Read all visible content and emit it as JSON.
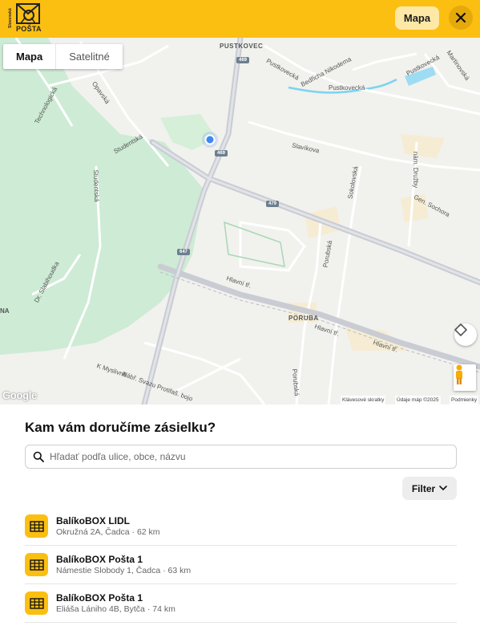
{
  "header": {
    "logo_side_text": "Slovenská",
    "logo_text": "POŠTA",
    "map_button": "Mapa",
    "close_icon": "close-icon"
  },
  "map": {
    "tabs": [
      {
        "label": "Mapa",
        "active": true
      },
      {
        "label": "Satelitné",
        "active": false
      }
    ],
    "labels": {
      "pustkovec": "PUSTKOVEC",
      "bedricha": "Bedřicha Nikodema",
      "pustkovecka1": "Pustkovecká",
      "pustkovecka2": "Pustkovecká",
      "pustkovecka3": "Pustkovecká",
      "martinovska": "Martinovská",
      "technologicka": "Technologická",
      "opavska": "Opavská",
      "studentska": "Studentská",
      "studentska2": "Studentská",
      "slavikova": "Slavíkova",
      "sokolovska": "Sokolovská",
      "druzby": "nám. Družby",
      "sochora": "Gen. Sochora",
      "porubska": "Porubská",
      "porubska2": "Porubská",
      "hlavni1": "Hlavní tř.",
      "hlavni2": "Hlavní tř.",
      "hlavni3": "Hlavní tř.",
      "poruba": "PORUBA",
      "slabihoudka": "Dr. Slabihoudka",
      "myslivne": "K Myslivně",
      "protifas": "Nábř. Svazu Protifaš. bojo",
      "na": "NA"
    },
    "shields": {
      "r469a": "469",
      "r469b": "469",
      "r479": "479",
      "r647": "647"
    },
    "google": "Google",
    "attribution": {
      "shortcuts": "Klávesové skratky",
      "mapdata": "Údaje máp ©2025",
      "terms": "Podmienky"
    },
    "colors": {
      "background": "#f1f1ee",
      "park": "#cdebd5",
      "road_major": "#c9ccd3",
      "water": "#7cd3f0",
      "location_dot": "#4285f4"
    }
  },
  "panel": {
    "title": "Kam vám doručíme zásielku?",
    "search_placeholder": "Hľadať podľa ulice, obce, názvu",
    "search_value": "",
    "filter_label": "Filter"
  },
  "results": [
    {
      "name": "BalíkoBOX LIDL",
      "detail": "Okružná 2A, Čadca · 62 km"
    },
    {
      "name": "BalíkoBOX Pošta 1",
      "detail": "Námestie Slobody 1, Čadca · 63 km"
    },
    {
      "name": "BalíkoBOX Pošta 1",
      "detail": "Eliáša Lániho 4B, Bytča · 74 km"
    }
  ],
  "brand_color": "#fbbf12"
}
